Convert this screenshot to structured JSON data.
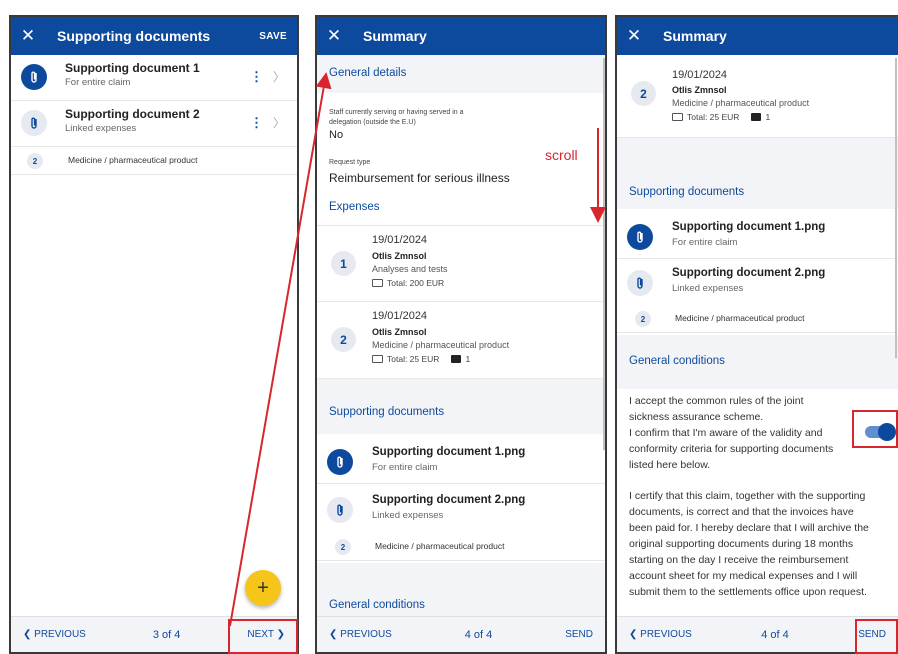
{
  "panel1": {
    "header": {
      "title": "Supporting documents",
      "save": "SAVE"
    },
    "docs": [
      {
        "title": "Supporting document 1",
        "sub": "For entire claim"
      },
      {
        "title": "Supporting document 2",
        "sub": "Linked expenses"
      }
    ],
    "link": {
      "num": "2",
      "text": "Medicine / pharmaceutical product"
    },
    "fab": "+",
    "footer": {
      "prev": "❮ PREVIOUS",
      "count": "3 of 4",
      "next": "NEXT ❯"
    }
  },
  "panel2": {
    "header": {
      "title": "Summary"
    },
    "general_details": "General details",
    "staff_label": "Staff currently serving or having served in a",
    "staff_label2": "delegation (outside the E.U)",
    "staff_value": "No",
    "request_label": "Request type",
    "request_value": "Reimbursement for serious illness",
    "expenses_title": "Expenses",
    "expenses": [
      {
        "num": "1",
        "date": "19/01/2024",
        "name": "Otlis Zmnsol",
        "category": "Analyses and tests",
        "total": "Total: 200 EUR",
        "bags": ""
      },
      {
        "num": "2",
        "date": "19/01/2024",
        "name": "Otlis Zmnsol",
        "category": "Medicine / pharmaceutical product",
        "total": "Total: 25 EUR",
        "bags": "1"
      }
    ],
    "supporting_title": "Supporting documents",
    "docs": [
      {
        "title": "Supporting document 1.png",
        "sub": "For entire claim"
      },
      {
        "title": "Supporting document 2.png",
        "sub": "Linked expenses"
      }
    ],
    "link": {
      "num": "2",
      "text": "Medicine / pharmaceutical product"
    },
    "conditions_title": "General conditions",
    "footer": {
      "prev": "❮ PREVIOUS",
      "count": "4 of 4",
      "send": "SEND"
    }
  },
  "panel3": {
    "header": {
      "title": "Summary"
    },
    "expense": {
      "num": "2",
      "date": "19/01/2024",
      "name": "Otlis Zmnsol",
      "category": "Medicine / pharmaceutical product",
      "total": "Total: 25 EUR",
      "bags": "1"
    },
    "supporting_title": "Supporting documents",
    "docs": [
      {
        "title": "Supporting document 1.png",
        "sub": "For entire claim"
      },
      {
        "title": "Supporting document 2.png",
        "sub": "Linked expenses"
      }
    ],
    "link": {
      "num": "2",
      "text": "Medicine / pharmaceutical product"
    },
    "conditions_title": "General conditions",
    "cond_lines_1": [
      "I accept the common rules of the joint",
      "sickness assurance scheme.",
      "I confirm that I'm aware of the validity and",
      "conformity criteria for supporting documents",
      "listed here below."
    ],
    "cond_lines_2": [
      "I certify that this claim, together with the supporting",
      "documents, is correct and that the invoices have",
      "been paid for. I hereby declare that I will archive the",
      "original supporting documents during 18 months",
      "starting on the day I receive the reimbursement",
      "account sheet for my medical expenses and I will",
      "submit them to the settlements office upon request."
    ],
    "toggle_on": true,
    "footer": {
      "prev": "❮ PREVIOUS",
      "count": "4 of 4",
      "send": "SEND"
    }
  },
  "annotation": {
    "scroll": "scroll"
  },
  "colors": {
    "brand": "#0d4a9e",
    "accent": "#f6c51a",
    "highlight": "#d9262c"
  }
}
